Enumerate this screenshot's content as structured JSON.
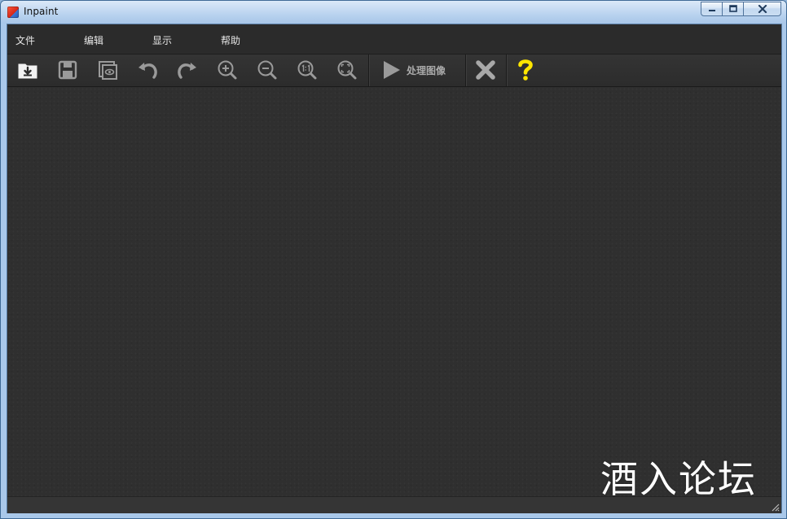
{
  "window": {
    "title": "Inpaint",
    "icon": "inpaint-app-icon",
    "controls": [
      "minimize",
      "maximize",
      "close"
    ]
  },
  "menubar": {
    "items": [
      {
        "label": "文件"
      },
      {
        "label": "编辑"
      },
      {
        "label": "显示"
      },
      {
        "label": "帮助"
      }
    ]
  },
  "toolbar": {
    "buttons": [
      {
        "icon": "open-folder-icon"
      },
      {
        "icon": "save-icon"
      },
      {
        "icon": "preview-icon"
      },
      {
        "icon": "undo-icon"
      },
      {
        "icon": "redo-icon"
      },
      {
        "icon": "zoom-in-icon"
      },
      {
        "icon": "zoom-out-icon"
      },
      {
        "icon": "zoom-actual-size-icon"
      },
      {
        "icon": "zoom-fit-icon"
      }
    ],
    "process_label": "处理图像",
    "clear_icon": "close-x-icon",
    "help_icon": "question-mark-icon"
  },
  "watermark": {
    "text": "酒入论坛"
  },
  "colors": {
    "canvas": "#2f2f2f",
    "toolbar": "#303030",
    "icon_gray": "#b4b4b4",
    "help_yellow": "#ffe600"
  }
}
